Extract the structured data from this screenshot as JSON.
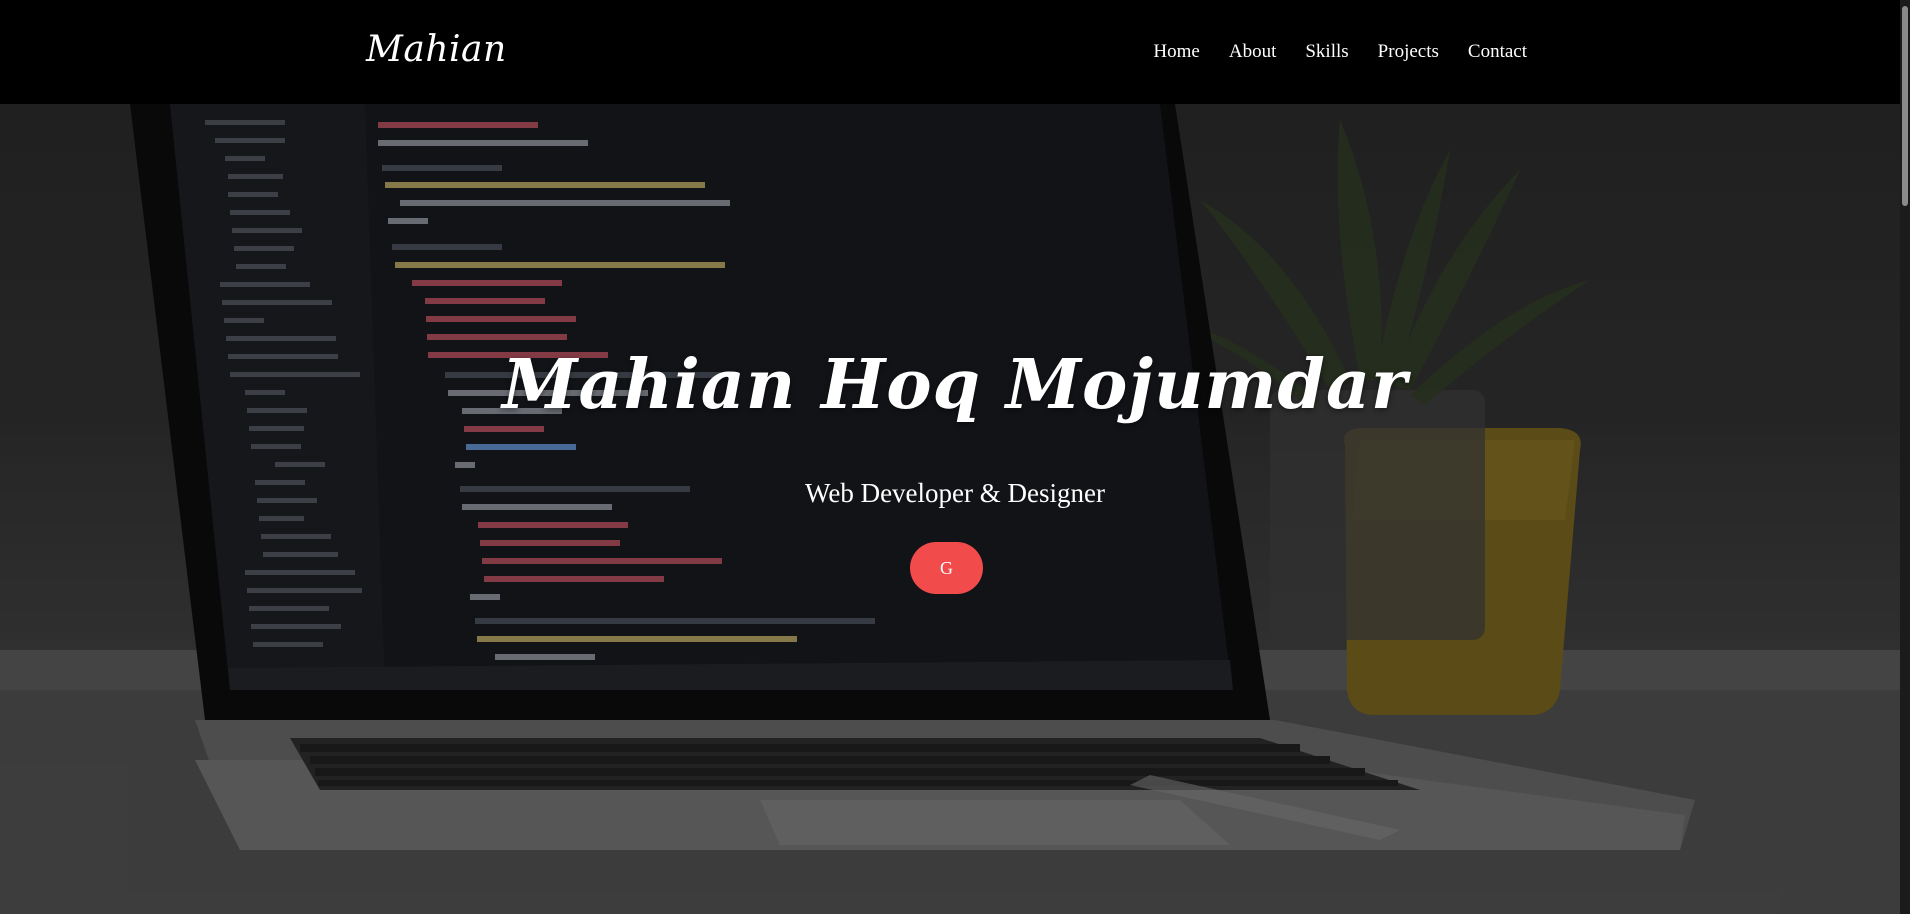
{
  "navbar": {
    "brand": "Mahian",
    "links": [
      {
        "label": "Home"
      },
      {
        "label": "About"
      },
      {
        "label": "Skills"
      },
      {
        "label": "Projects"
      },
      {
        "label": "Contact"
      }
    ]
  },
  "hero": {
    "name": "Mahian Hoq Mojumdar",
    "subtitle": "Web Developer & Designer",
    "button_label": "G",
    "button_color": "#f24b4b",
    "background_image": "laptop-with-code-editor-and-plant"
  },
  "colors": {
    "navbar_bg": "#000000",
    "text": "#ffffff",
    "accent": "#f24b4b"
  }
}
